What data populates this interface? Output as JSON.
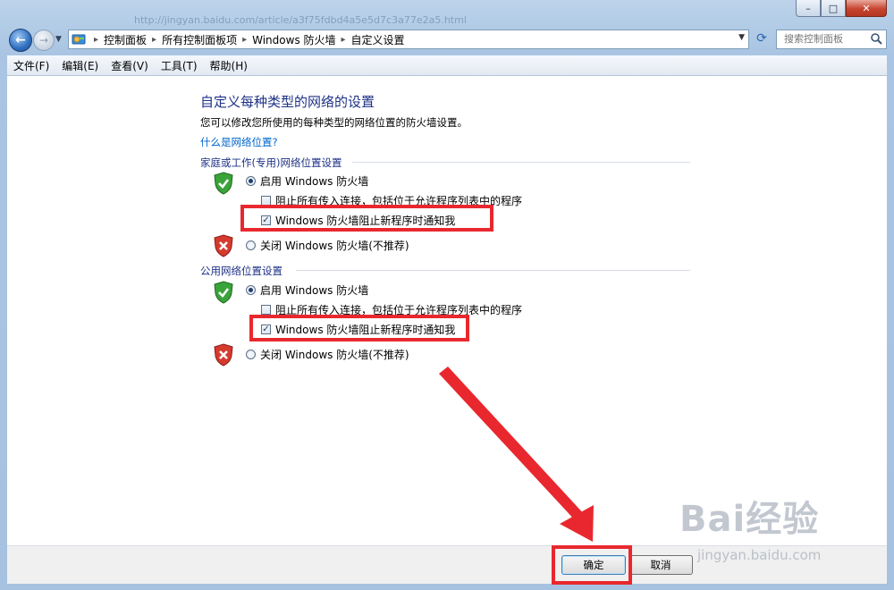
{
  "window": {
    "ghost_url": "http://jingyan.baidu.com/article/a3f75fdbd4a5e5d7c3a77e2a5.html"
  },
  "nav": {
    "breadcrumbs": [
      "控制面板",
      "所有控制面板项",
      "Windows 防火墙",
      "自定义设置"
    ],
    "search_placeholder": "搜索控制面板"
  },
  "menu": {
    "items": [
      "文件(F)",
      "编辑(E)",
      "查看(V)",
      "工具(T)",
      "帮助(H)"
    ]
  },
  "main": {
    "heading": "自定义每种类型的网络的设置",
    "description": "您可以修改您所使用的每种类型的网络位置的防火墙设置。",
    "link": "什么是网络位置?",
    "private": {
      "title": "家庭或工作(专用)网络位置设置",
      "enable_label": "启用 Windows 防火墙",
      "enable_selected": true,
      "block_all_label": "阻止所有传入连接，包括位于允许程序列表中的程序",
      "block_all_checked": false,
      "notify_label": "Windows 防火墙阻止新程序时通知我",
      "notify_checked": true,
      "disable_label": "关闭 Windows 防火墙(不推荐)",
      "disable_selected": false
    },
    "public": {
      "title": "公用网络位置设置",
      "enable_label": "启用 Windows 防火墙",
      "enable_selected": true,
      "block_all_label": "阻止所有传入连接，包括位于允许程序列表中的程序",
      "block_all_checked": false,
      "notify_label": "Windows 防火墙阻止新程序时通知我",
      "notify_checked": true,
      "disable_label": "关闭 Windows 防火墙(不推荐)",
      "disable_selected": false
    }
  },
  "footer": {
    "ok_label": "确定",
    "cancel_label": "取消"
  },
  "annotation": {
    "color": "#e8282e"
  },
  "watermark": {
    "brand": "Bai经验",
    "url": "jingyan.baidu.com"
  },
  "colors": {
    "heading": "#1e3287",
    "link": "#0066cc",
    "frame": "#a9c5e3"
  }
}
